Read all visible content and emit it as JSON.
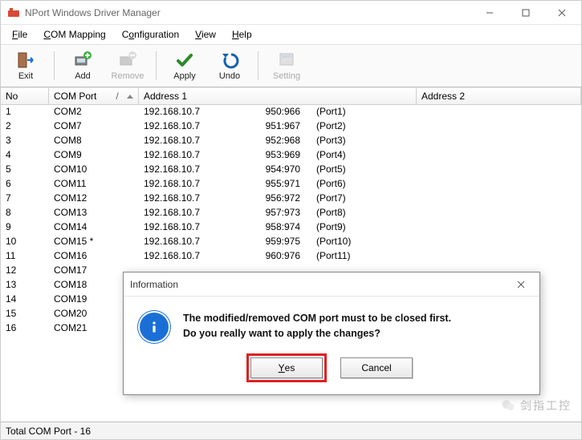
{
  "window": {
    "title": "NPort Windows Driver Manager"
  },
  "menu": {
    "file": "File",
    "com_mapping": "COM Mapping",
    "configuration": "Configuration",
    "view": "View",
    "help": "Help"
  },
  "toolbar": {
    "exit": "Exit",
    "add": "Add",
    "remove": "Remove",
    "apply": "Apply",
    "undo": "Undo",
    "setting": "Setting"
  },
  "columns": {
    "no": "No",
    "com_port": "COM Port",
    "addr1": "Address 1",
    "addr2": "Address 2"
  },
  "rows": [
    {
      "no": "1",
      "com": "COM2",
      "ip": "192.168.10.7",
      "ports": "950:966",
      "pname": "(Port1)"
    },
    {
      "no": "2",
      "com": "COM7",
      "ip": "192.168.10.7",
      "ports": "951:967",
      "pname": "(Port2)"
    },
    {
      "no": "3",
      "com": "COM8",
      "ip": "192.168.10.7",
      "ports": "952:968",
      "pname": "(Port3)"
    },
    {
      "no": "4",
      "com": "COM9",
      "ip": "192.168.10.7",
      "ports": "953:969",
      "pname": "(Port4)"
    },
    {
      "no": "5",
      "com": "COM10",
      "ip": "192.168.10.7",
      "ports": "954:970",
      "pname": "(Port5)"
    },
    {
      "no": "6",
      "com": "COM11",
      "ip": "192.168.10.7",
      "ports": "955:971",
      "pname": "(Port6)"
    },
    {
      "no": "7",
      "com": "COM12",
      "ip": "192.168.10.7",
      "ports": "956:972",
      "pname": "(Port7)"
    },
    {
      "no": "8",
      "com": "COM13",
      "ip": "192.168.10.7",
      "ports": "957:973",
      "pname": "(Port8)"
    },
    {
      "no": "9",
      "com": "COM14",
      "ip": "192.168.10.7",
      "ports": "958:974",
      "pname": "(Port9)"
    },
    {
      "no": "10",
      "com": "COM15 *",
      "ip": "192.168.10.7",
      "ports": "959:975",
      "pname": "(Port10)"
    },
    {
      "no": "11",
      "com": "COM16",
      "ip": "192.168.10.7",
      "ports": "960:976",
      "pname": "(Port11)"
    },
    {
      "no": "12",
      "com": "COM17",
      "ip": "",
      "ports": "",
      "pname": ""
    },
    {
      "no": "13",
      "com": "COM18",
      "ip": "",
      "ports": "",
      "pname": ""
    },
    {
      "no": "14",
      "com": "COM19",
      "ip": "",
      "ports": "",
      "pname": ""
    },
    {
      "no": "15",
      "com": "COM20",
      "ip": "",
      "ports": "",
      "pname": ""
    },
    {
      "no": "16",
      "com": "COM21",
      "ip": "",
      "ports": "",
      "pname": ""
    }
  ],
  "status": {
    "text": "Total COM Port - 16"
  },
  "dialog": {
    "title": "Information",
    "line1": "The modified/removed COM port must to be closed first.",
    "line2": "Do you really want to apply the changes?",
    "yes": "Yes",
    "cancel": "Cancel"
  },
  "watermark": "剑指工控"
}
